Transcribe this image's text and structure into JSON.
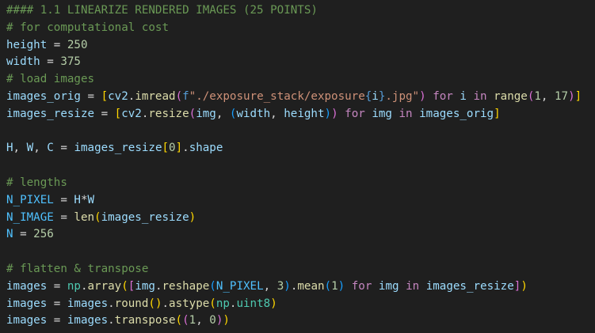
{
  "editor": {
    "colors": {
      "background": "#1f1f1f",
      "comment": "#6a9955",
      "variable": "#9cdcfe",
      "constant": "#4fc1ff",
      "operator": "#d4d4d4",
      "number": "#b5cea8",
      "function": "#dcdcaa",
      "string": "#ce9178",
      "keyword": "#c586c0",
      "class": "#4ec9b0",
      "storage": "#569cd6",
      "bracket1": "#ffd700",
      "bracket2": "#da70d6",
      "bracket3": "#179fff"
    },
    "lines": [
      [
        [
          "comment",
          "#### 1.1 LINEARIZE RENDERED IMAGES (25 POINTS)"
        ]
      ],
      [
        [
          "comment",
          "# for computational cost"
        ]
      ],
      [
        [
          "variable",
          "height"
        ],
        [
          "operator",
          " = "
        ],
        [
          "number",
          "250"
        ]
      ],
      [
        [
          "variable",
          "width"
        ],
        [
          "operator",
          " = "
        ],
        [
          "number",
          "375"
        ]
      ],
      [
        [
          "comment",
          "# load images"
        ]
      ],
      [
        [
          "variable",
          "images_orig"
        ],
        [
          "operator",
          " = "
        ],
        [
          "bracket1",
          "["
        ],
        [
          "variable",
          "cv2"
        ],
        [
          "operator",
          "."
        ],
        [
          "function",
          "imread"
        ],
        [
          "bracket2",
          "("
        ],
        [
          "storage",
          "f"
        ],
        [
          "string",
          "\"./exposure_stack/exposure"
        ],
        [
          "storage",
          "{"
        ],
        [
          "variable",
          "i"
        ],
        [
          "storage",
          "}"
        ],
        [
          "string",
          ".jpg\""
        ],
        [
          "bracket2",
          ")"
        ],
        [
          "operator",
          " "
        ],
        [
          "keyword",
          "for"
        ],
        [
          "operator",
          " "
        ],
        [
          "variable",
          "i"
        ],
        [
          "operator",
          " "
        ],
        [
          "keyword",
          "in"
        ],
        [
          "operator",
          " "
        ],
        [
          "function",
          "range"
        ],
        [
          "bracket2",
          "("
        ],
        [
          "number",
          "1"
        ],
        [
          "operator",
          ", "
        ],
        [
          "number",
          "17"
        ],
        [
          "bracket2",
          ")"
        ],
        [
          "bracket1",
          "]"
        ]
      ],
      [
        [
          "variable",
          "images_resize"
        ],
        [
          "operator",
          " = "
        ],
        [
          "bracket1",
          "["
        ],
        [
          "variable",
          "cv2"
        ],
        [
          "operator",
          "."
        ],
        [
          "function",
          "resize"
        ],
        [
          "bracket2",
          "("
        ],
        [
          "variable",
          "img"
        ],
        [
          "operator",
          ", "
        ],
        [
          "bracket3",
          "("
        ],
        [
          "variable",
          "width"
        ],
        [
          "operator",
          ", "
        ],
        [
          "variable",
          "height"
        ],
        [
          "bracket3",
          ")"
        ],
        [
          "bracket2",
          ")"
        ],
        [
          "operator",
          " "
        ],
        [
          "keyword",
          "for"
        ],
        [
          "operator",
          " "
        ],
        [
          "variable",
          "img"
        ],
        [
          "operator",
          " "
        ],
        [
          "keyword",
          "in"
        ],
        [
          "operator",
          " "
        ],
        [
          "variable",
          "images_orig"
        ],
        [
          "bracket1",
          "]"
        ]
      ],
      [],
      [
        [
          "variable",
          "H"
        ],
        [
          "operator",
          ", "
        ],
        [
          "variable",
          "W"
        ],
        [
          "operator",
          ", "
        ],
        [
          "variable",
          "C"
        ],
        [
          "operator",
          " = "
        ],
        [
          "variable",
          "images_resize"
        ],
        [
          "bracket1",
          "["
        ],
        [
          "number",
          "0"
        ],
        [
          "bracket1",
          "]"
        ],
        [
          "operator",
          "."
        ],
        [
          "variable",
          "shape"
        ]
      ],
      [],
      [
        [
          "comment",
          "# lengths"
        ]
      ],
      [
        [
          "constant",
          "N_PIXEL"
        ],
        [
          "operator",
          " = "
        ],
        [
          "variable",
          "H"
        ],
        [
          "operator",
          "*"
        ],
        [
          "variable",
          "W"
        ]
      ],
      [
        [
          "constant",
          "N_IMAGE"
        ],
        [
          "operator",
          " = "
        ],
        [
          "function",
          "len"
        ],
        [
          "bracket1",
          "("
        ],
        [
          "variable",
          "images_resize"
        ],
        [
          "bracket1",
          ")"
        ]
      ],
      [
        [
          "constant",
          "N"
        ],
        [
          "operator",
          " = "
        ],
        [
          "number",
          "256"
        ]
      ],
      [],
      [
        [
          "comment",
          "# flatten & transpose"
        ]
      ],
      [
        [
          "variable",
          "images"
        ],
        [
          "operator",
          " = "
        ],
        [
          "class",
          "np"
        ],
        [
          "operator",
          "."
        ],
        [
          "function",
          "array"
        ],
        [
          "bracket1",
          "("
        ],
        [
          "bracket2",
          "["
        ],
        [
          "variable",
          "img"
        ],
        [
          "operator",
          "."
        ],
        [
          "function",
          "reshape"
        ],
        [
          "bracket3",
          "("
        ],
        [
          "constant",
          "N_PIXEL"
        ],
        [
          "operator",
          ", "
        ],
        [
          "number",
          "3"
        ],
        [
          "bracket3",
          ")"
        ],
        [
          "operator",
          "."
        ],
        [
          "function",
          "mean"
        ],
        [
          "bracket3",
          "("
        ],
        [
          "number",
          "1"
        ],
        [
          "bracket3",
          ")"
        ],
        [
          "operator",
          " "
        ],
        [
          "keyword",
          "for"
        ],
        [
          "operator",
          " "
        ],
        [
          "variable",
          "img"
        ],
        [
          "operator",
          " "
        ],
        [
          "keyword",
          "in"
        ],
        [
          "operator",
          " "
        ],
        [
          "variable",
          "images_resize"
        ],
        [
          "bracket2",
          "]"
        ],
        [
          "bracket1",
          ")"
        ]
      ],
      [
        [
          "variable",
          "images"
        ],
        [
          "operator",
          " = "
        ],
        [
          "variable",
          "images"
        ],
        [
          "operator",
          "."
        ],
        [
          "function",
          "round"
        ],
        [
          "bracket1",
          "("
        ],
        [
          "bracket1",
          ")"
        ],
        [
          "operator",
          "."
        ],
        [
          "function",
          "astype"
        ],
        [
          "bracket1",
          "("
        ],
        [
          "class",
          "np"
        ],
        [
          "operator",
          "."
        ],
        [
          "class",
          "uint8"
        ],
        [
          "bracket1",
          ")"
        ]
      ],
      [
        [
          "variable",
          "images"
        ],
        [
          "operator",
          " = "
        ],
        [
          "variable",
          "images"
        ],
        [
          "operator",
          "."
        ],
        [
          "function",
          "transpose"
        ],
        [
          "bracket1",
          "("
        ],
        [
          "bracket2",
          "("
        ],
        [
          "number",
          "1"
        ],
        [
          "operator",
          ", "
        ],
        [
          "number",
          "0"
        ],
        [
          "bracket2",
          ")"
        ],
        [
          "bracket1",
          ")"
        ]
      ]
    ]
  }
}
